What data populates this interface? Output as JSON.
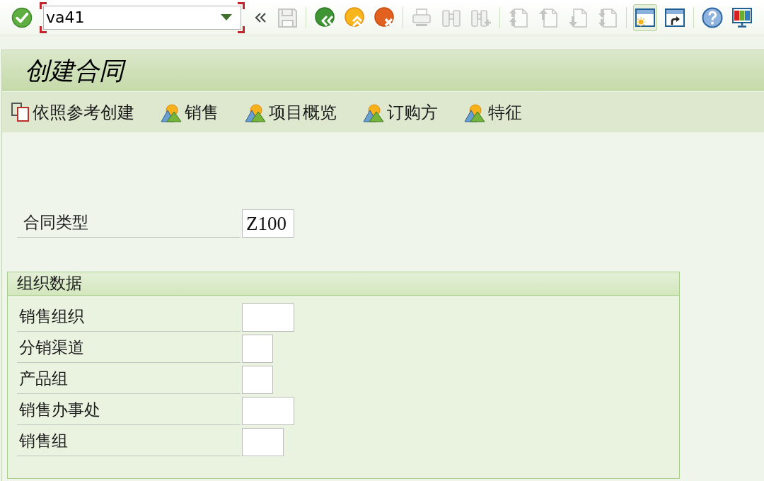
{
  "system_toolbar": {
    "items": [
      {
        "kind": "confirm",
        "disabled": false,
        "highlighted": false
      },
      {
        "kind": "command_field",
        "value": "va41",
        "focused": true
      },
      {
        "kind": "collapse",
        "disabled": false,
        "highlighted": false
      },
      {
        "kind": "save",
        "disabled": true,
        "highlighted": false
      },
      {
        "kind": "separator"
      },
      {
        "kind": "back",
        "disabled": false,
        "highlighted": false
      },
      {
        "kind": "exit",
        "disabled": false,
        "highlighted": false
      },
      {
        "kind": "cancel",
        "disabled": false,
        "highlighted": false
      },
      {
        "kind": "separator"
      },
      {
        "kind": "print",
        "disabled": true,
        "highlighted": false
      },
      {
        "kind": "find",
        "disabled": true,
        "highlighted": false
      },
      {
        "kind": "find_next",
        "disabled": true,
        "highlighted": false
      },
      {
        "kind": "separator"
      },
      {
        "kind": "first_page",
        "disabled": true,
        "highlighted": false
      },
      {
        "kind": "previous_page",
        "disabled": true,
        "highlighted": false
      },
      {
        "kind": "next_page",
        "disabled": true,
        "highlighted": false
      },
      {
        "kind": "last_page",
        "disabled": true,
        "highlighted": false
      },
      {
        "kind": "separator"
      },
      {
        "kind": "new_session",
        "disabled": false,
        "highlighted": true
      },
      {
        "kind": "shortcut",
        "disabled": false,
        "highlighted": false
      },
      {
        "kind": "separator"
      },
      {
        "kind": "help",
        "disabled": false,
        "highlighted": false
      },
      {
        "kind": "layout",
        "disabled": false,
        "highlighted": false
      }
    ]
  },
  "screen_title": "创建合同",
  "application_toolbar": [
    {
      "kind": "copy",
      "label": "依照参考创建"
    },
    {
      "kind": "overview",
      "label": "销售"
    },
    {
      "kind": "overview",
      "label": "项目概览"
    },
    {
      "kind": "overview",
      "label": "订购方"
    },
    {
      "kind": "overview",
      "label": "特征"
    }
  ],
  "header_fields": [
    {
      "label": "合同类型",
      "value": "Z100"
    }
  ],
  "organization_data": {
    "title": "组织数据",
    "fields": [
      {
        "label": "销售组织"
      },
      {
        "label": "分销渠道"
      },
      {
        "label": "产品组"
      },
      {
        "label": "销售办事处"
      },
      {
        "label": "销售组"
      }
    ]
  }
}
